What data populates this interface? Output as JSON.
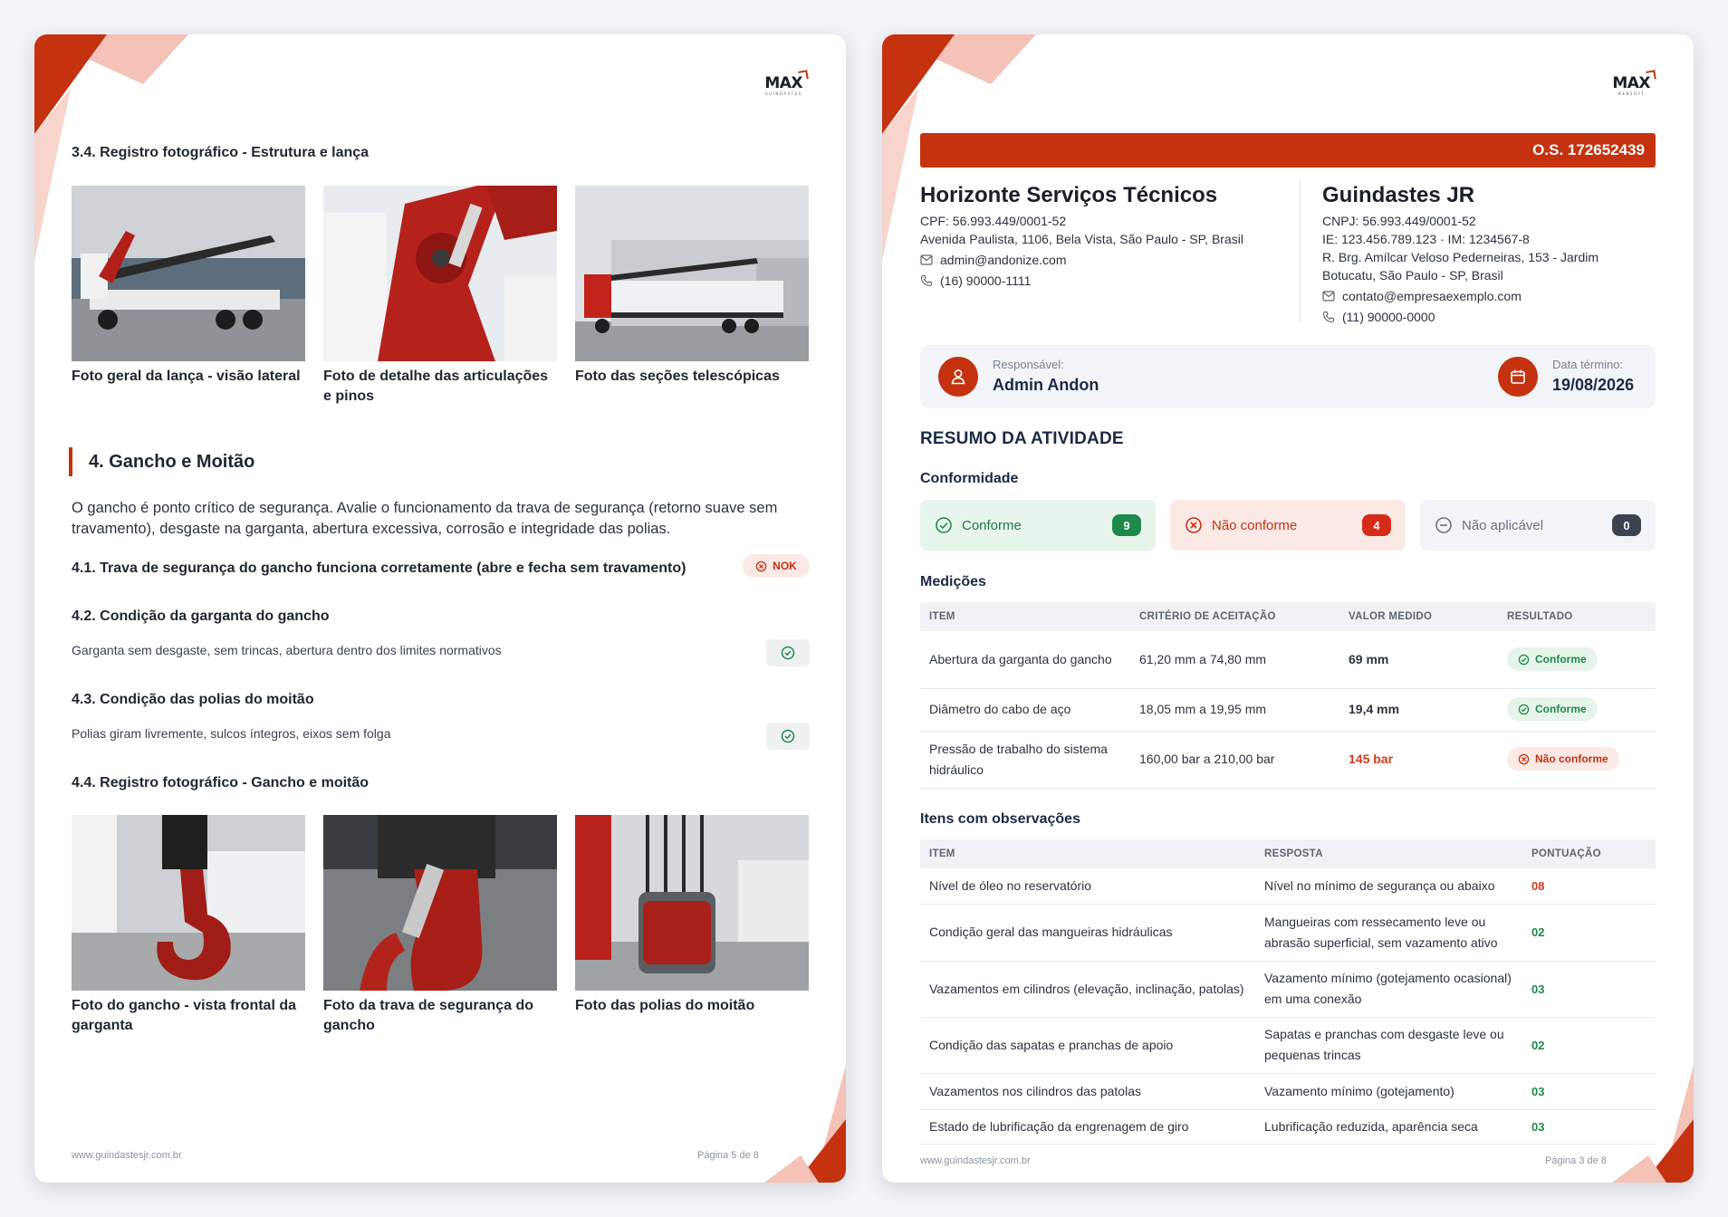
{
  "left_page": {
    "section_3_4_title": "3.4. Registro fotográfico - Estrutura e lança",
    "photos_1": [
      {
        "caption": "Foto geral da lança - visão lateral"
      },
      {
        "caption": "Foto de detalhe das articulações e pinos"
      },
      {
        "caption": "Foto das seções telescópicas"
      }
    ],
    "section_4_title": "4. Gancho e Moitão",
    "section_4_text": "O gancho é ponto crítico de segurança. Avalie o funcionamento da trava de segurança (retorno suave sem travamento), desgaste na garganta, abertura excessiva, corrosão e integridade das polias.",
    "q41": {
      "label": "4.1. Trava de segurança do gancho funciona corretamente (abre e fecha sem travamento)",
      "status": "NOK"
    },
    "q42": {
      "label": "4.2. Condição da garganta do gancho",
      "answer": "Garganta sem desgaste, sem trincas, abertura dentro dos limites normativos"
    },
    "q43": {
      "label": "4.3. Condição das polias do moitão",
      "answer": "Polias giram livremente, sulcos íntegros, eixos sem folga"
    },
    "section_4_4_title": "4.4. Registro fotográfico - Gancho e moitão",
    "photos_2": [
      {
        "caption": "Foto do gancho - vista frontal da garganta"
      },
      {
        "caption": "Foto da trava de segurança do gancho"
      },
      {
        "caption": "Foto das polias do moitão"
      }
    ],
    "footer_site": "www.guindastesjr.com.br",
    "footer_page": "Página 5 de 8"
  },
  "right_page": {
    "os_label": "O.S. 172652439",
    "provider": {
      "name": "Horizonte Serviços Técnicos",
      "doc": "CPF: 56.993.449/0001-52",
      "address": "Avenida Paulista, 1106, Bela Vista, São Paulo - SP, Brasil",
      "email": "admin@andonize.com",
      "phone": "(16) 90000-1111"
    },
    "client": {
      "name": "Guindastes JR",
      "doc": "CNPJ: 56.993.449/0001-52",
      "ie": "IE: 123.456.789.123  ·  IM: 1234567-8",
      "address1": "R. Brg. Amílcar Veloso Pederneiras, 153 - Jardim",
      "address2": "Botucatu, São Paulo - SP, Brasil",
      "email": "contato@empresaexemplo.com",
      "phone": "(11) 90000-0000"
    },
    "responsible_label": "Responsável:",
    "responsible_value": "Admin Andon",
    "end_date_label": "Data término:",
    "end_date_value": "19/08/2026",
    "summary_title": "RESUMO DA ATIVIDADE",
    "conformity_title": "Conformidade",
    "conformity": {
      "conforme": {
        "label": "Conforme",
        "count": "9"
      },
      "nao_conforme": {
        "label": "Não conforme",
        "count": "4"
      },
      "nao_aplicavel": {
        "label": "Não aplicável",
        "count": "0"
      }
    },
    "measurements_title": "Medições",
    "measurements_headers": [
      "ITEM",
      "CRITÉRIO DE ACEITAÇÃO",
      "VALOR MEDIDO",
      "RESULTADO"
    ],
    "measurements": [
      {
        "item": "Abertura da garganta do gancho",
        "criterion": "61,20 mm a 74,80 mm",
        "value": "69 mm",
        "result": "Conforme",
        "ok": true
      },
      {
        "item": "Diâmetro do cabo de aço",
        "criterion": "18,05 mm a 19,95 mm",
        "value": "19,4 mm",
        "result": "Conforme",
        "ok": true
      },
      {
        "item": "Pressão de trabalho do sistema hidráulico",
        "criterion": "160,00 bar a 210,00 bar",
        "value": "145 bar",
        "result": "Não conforme",
        "ok": false
      }
    ],
    "observations_title": "Itens com observações",
    "observations_headers": [
      "ITEM",
      "RESPOSTA",
      "PONTUAÇÃO"
    ],
    "observations": [
      {
        "item": "Nível de óleo no reservatório",
        "answer": "Nível no mínimo de segurança ou abaixo",
        "score": "08",
        "color": "#d23a1f"
      },
      {
        "item": "Condição geral das mangueiras hidráulicas",
        "answer": "Mangueiras com ressecamento leve ou abrasão superficial, sem vazamento ativo",
        "score": "02",
        "color": "#1e8a4a"
      },
      {
        "item": "Vazamentos em cilindros (elevação, inclinação, patolas)",
        "answer": "Vazamento mínimo (gotejamento ocasional) em uma conexão",
        "score": "03",
        "color": "#1e8a4a"
      },
      {
        "item": "Condição das sapatas e pranchas de apoio",
        "answer": "Sapatas e pranchas com desgaste leve ou pequenas trincas",
        "score": "02",
        "color": "#1e8a4a"
      },
      {
        "item": "Vazamentos nos cilindros das patolas",
        "answer": "Vazamento mínimo (gotejamento)",
        "score": "03",
        "color": "#1e8a4a"
      },
      {
        "item": "Estado de lubrificação da engrenagem de giro",
        "answer": "Lubrificação reduzida, aparência seca",
        "score": "03",
        "color": "#1e8a4a"
      }
    ],
    "footer_site": "www.guindastesjr.com.br",
    "footer_page": "Página 3 de 8"
  },
  "colors": {
    "accent": "#c4320f",
    "accent_light": "#f2b7aa",
    "ok": "#1e8a4a",
    "navy": "#1b2a44"
  },
  "logo_text": "MAX"
}
